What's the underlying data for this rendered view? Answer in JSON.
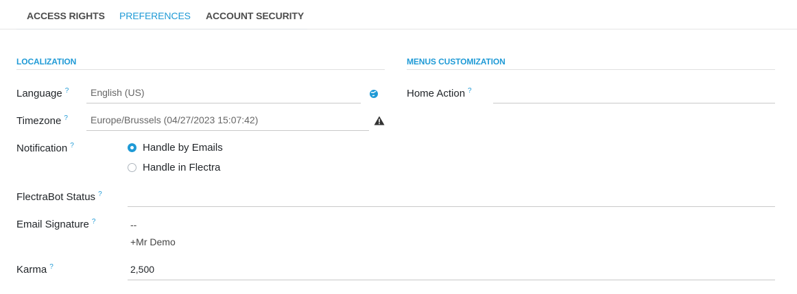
{
  "tabs": [
    {
      "label": "ACCESS RIGHTS",
      "active": false
    },
    {
      "label": "PREFERENCES",
      "active": true
    },
    {
      "label": "ACCOUNT SECURITY",
      "active": false
    }
  ],
  "localization": {
    "title": "LOCALIZATION",
    "language_label": "Language",
    "language_value": "English (US)",
    "timezone_label": "Timezone",
    "timezone_value": "Europe/Brussels (04/27/2023 15:07:42)",
    "notification_label": "Notification",
    "notification_options": [
      "Handle by Emails",
      "Handle in Flectra"
    ],
    "notification_selected": "Handle by Emails"
  },
  "menus": {
    "title": "MENUS CUSTOMIZATION",
    "home_action_label": "Home Action",
    "home_action_value": ""
  },
  "bot": {
    "label": "FlectraBot Status",
    "value": ""
  },
  "signature": {
    "label": "Email Signature",
    "line1": "--",
    "line2": "+Mr Demo"
  },
  "karma": {
    "label": "Karma",
    "value": "2,500"
  },
  "help_mark": "?",
  "icons": {
    "language": "globe-icon",
    "timezone": "warning-icon"
  },
  "colors": {
    "accent": "#1f9ad6",
    "text": "#212529"
  }
}
